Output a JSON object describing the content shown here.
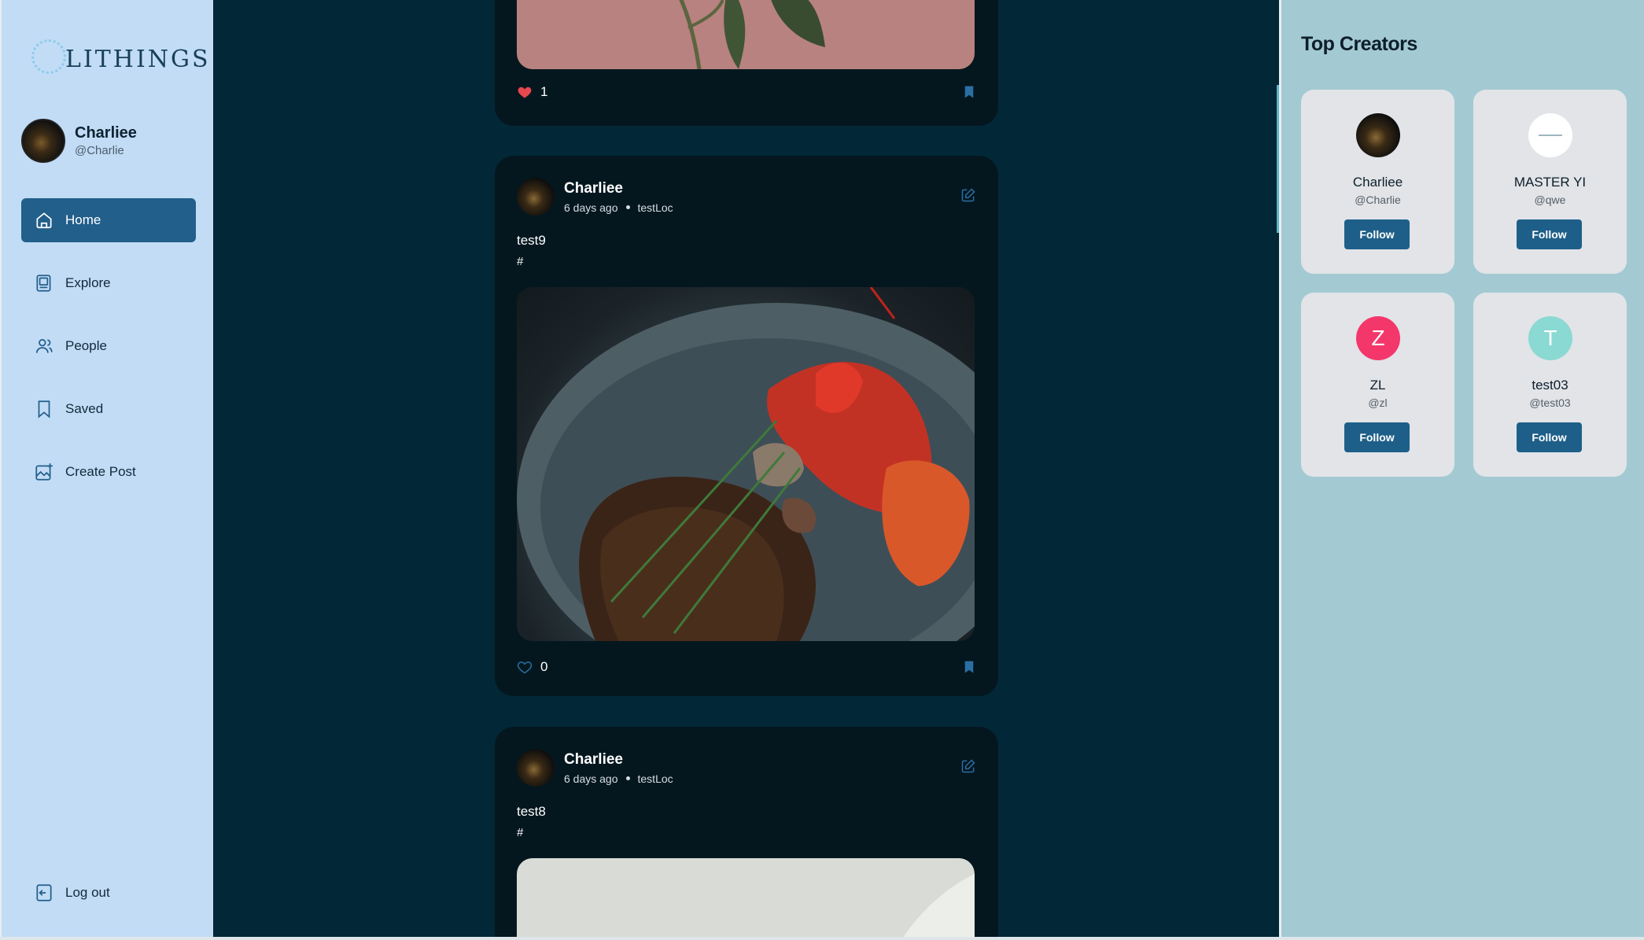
{
  "app": {
    "logo": "LITHINGS"
  },
  "profile": {
    "name": "Charliee",
    "handle": "@Charlie"
  },
  "nav": {
    "home": "Home",
    "explore": "Explore",
    "people": "People",
    "saved": "Saved",
    "create": "Create Post",
    "logout": "Log out"
  },
  "posts": [
    {
      "likes": "1",
      "liked": true
    },
    {
      "author": "Charliee",
      "time": "6 days ago",
      "location": "testLoc",
      "caption": "test9",
      "tags": "#",
      "likes": "0",
      "liked": false
    },
    {
      "author": "Charliee",
      "time": "6 days ago",
      "location": "testLoc",
      "caption": "test8",
      "tags": "#"
    }
  ],
  "right_panel": {
    "title": "Top Creators",
    "creators": [
      {
        "name": "Charliee",
        "handle": "@Charlie",
        "follow": "Follow"
      },
      {
        "name": "MASTER YI",
        "handle": "@qwe",
        "follow": "Follow"
      },
      {
        "name": "ZL",
        "handle": "@zl",
        "initial": "Z",
        "follow": "Follow",
        "color": "#f4376b"
      },
      {
        "name": "test03",
        "handle": "@test03",
        "initial": "T",
        "follow": "Follow",
        "color": "#8ad9d2"
      }
    ]
  },
  "colors": {
    "accent": "#225f8a",
    "sidebar": "#c2dcf6",
    "feed_bg": "#022838",
    "card_bg": "#04171f",
    "right_bg": "#a3cad2",
    "like": "#e5484d"
  }
}
